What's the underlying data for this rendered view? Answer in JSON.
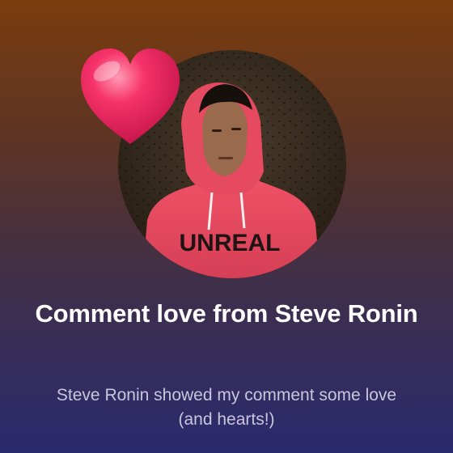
{
  "notification": {
    "title": "Comment love from Steve Ronin",
    "body": "Steve Ronin showed my comment some love (and hearts!)"
  },
  "avatar": {
    "person": "Steve Ronin",
    "hoodie_text": "UNREAL"
  },
  "icons": {
    "reaction": "heart-icon"
  },
  "colors": {
    "heart": "#f0245e",
    "hoodie": "#e5455c",
    "title_text": "#ffffff",
    "body_text": "#c8c6dc"
  }
}
